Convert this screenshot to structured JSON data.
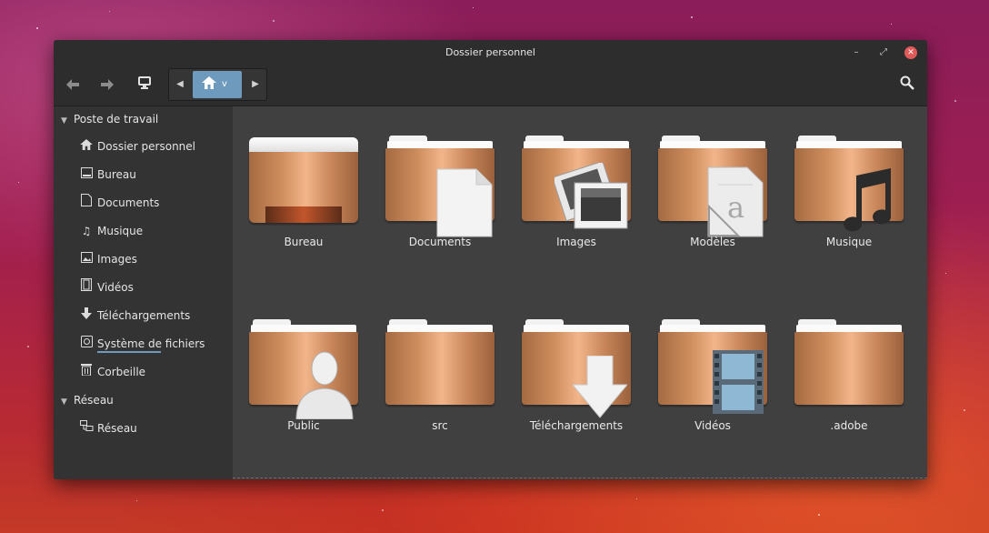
{
  "window": {
    "title": "Dossier personnel"
  },
  "toolbar": {
    "back_icon": "back-arrow-icon",
    "forward_icon": "forward-arrow-icon",
    "computer_icon": "computer-icon",
    "path_current": "v",
    "search_icon": "search-icon"
  },
  "sidebar": {
    "section_places": "Poste de travail",
    "places": [
      {
        "label": "Dossier personnel",
        "icon": "home-icon"
      },
      {
        "label": "Bureau",
        "icon": "desktop-icon"
      },
      {
        "label": "Documents",
        "icon": "document-icon"
      },
      {
        "label": "Musique",
        "icon": "music-icon"
      },
      {
        "label": "Images",
        "icon": "image-icon"
      },
      {
        "label": "Vidéos",
        "icon": "video-icon"
      },
      {
        "label": "Téléchargements",
        "icon": "download-icon"
      },
      {
        "label": "Système de fichiers",
        "icon": "filesystem-icon"
      },
      {
        "label": "Corbeille",
        "icon": "trash-icon"
      }
    ],
    "section_network": "Réseau",
    "network": [
      {
        "label": "Réseau",
        "icon": "network-icon"
      }
    ]
  },
  "files": [
    {
      "label": "Bureau"
    },
    {
      "label": "Documents"
    },
    {
      "label": "Images"
    },
    {
      "label": "Modèles"
    },
    {
      "label": "Musique"
    },
    {
      "label": "Public"
    },
    {
      "label": "src"
    },
    {
      "label": "Téléchargements"
    },
    {
      "label": "Vidéos"
    },
    {
      "label": ".adobe"
    }
  ]
}
